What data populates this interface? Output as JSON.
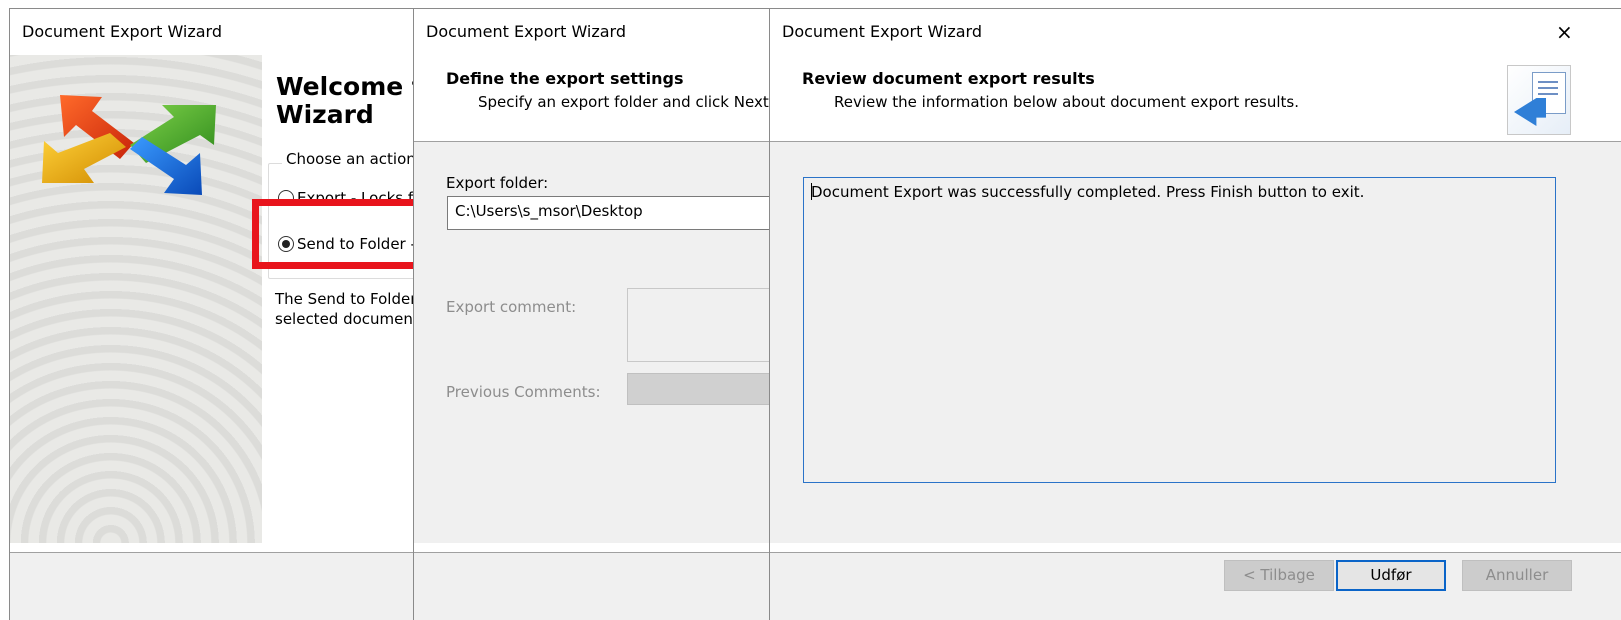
{
  "windows": [
    {
      "title": "Document Export Wizard",
      "welcome_line1": "Welcome to",
      "welcome_line2": "Wizard",
      "group_label": "Choose an action t",
      "options": [
        {
          "label": "Export - Locks f",
          "selected": false
        },
        {
          "label": "Send to Folder -",
          "selected": true
        }
      ],
      "description_line1": "The Send to Folder d",
      "description_line2": "selected documents"
    },
    {
      "title": "Document Export Wizard",
      "header_title": "Define the export settings",
      "header_subtitle": "Specify an export folder and click Next to",
      "export_folder_label": "Export folder:",
      "export_folder_value": "C:\\Users\\s_msor\\Desktop",
      "export_comment_label": "Export comment:",
      "previous_comments_label": "Previous Comments:"
    },
    {
      "title": "Document Export Wizard",
      "close_glyph": "×",
      "header_title": "Review document export results",
      "header_subtitle": "Review the information below about document export results.",
      "result_text": "Document Export was successfully completed. Press Finish button to exit.",
      "buttons": {
        "back": "< Tilbage",
        "finish": "Udfør",
        "cancel": "Annuller"
      }
    }
  ],
  "colors": {
    "highlight_red": "#e8141c",
    "focus_blue": "#2a73c8",
    "panel_grey": "#f0f0f0"
  }
}
